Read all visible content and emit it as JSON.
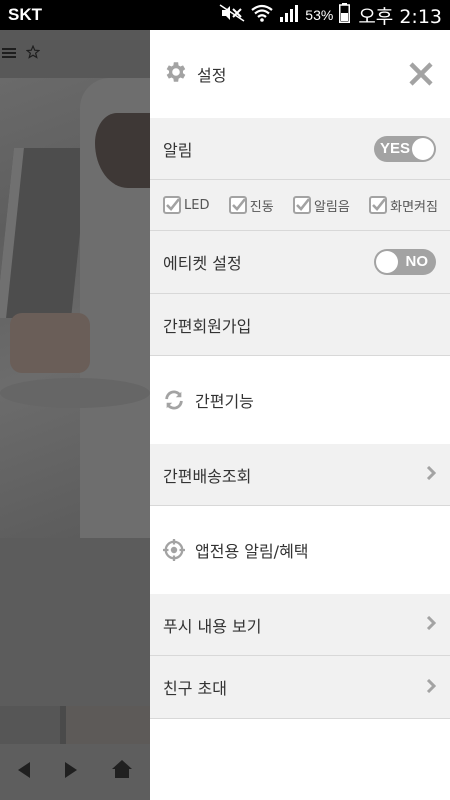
{
  "status_bar": {
    "carrier": "SKT",
    "battery_percent": "53%",
    "time": "오후 2:13",
    "icons": [
      "mute-icon",
      "wifi-icon",
      "signal-icon",
      "battery-icon"
    ]
  },
  "background_app": {
    "toolbar_icons": [
      "menu-icon",
      "star-icon"
    ],
    "nav_icons": [
      "back-arrow-icon",
      "forward-arrow-icon",
      "home-icon"
    ]
  },
  "drawer": {
    "header": {
      "icon": "gear-icon",
      "title": "설정",
      "close_icon": "close-icon"
    },
    "notification": {
      "label": "알림",
      "toggle": "YES",
      "toggle_state": "on"
    },
    "checkboxes": [
      {
        "label": "LED",
        "checked": true
      },
      {
        "label": "진동",
        "checked": true
      },
      {
        "label": "알림음",
        "checked": true
      },
      {
        "label": "화면켜짐",
        "checked": true
      }
    ],
    "etiquette": {
      "label": "에티켓 설정",
      "toggle": "NO",
      "toggle_state": "off"
    },
    "signup": {
      "label": "간편회원가입"
    },
    "easy_feature": {
      "icon": "refresh-icon",
      "label": "간편기능"
    },
    "delivery": {
      "label": "간편배송조회",
      "arrow": "chevron-right-icon"
    },
    "app_benefit": {
      "icon": "target-icon",
      "label": "앱전용 알림/혜택"
    },
    "push_view": {
      "label": "푸시 내용 보기",
      "arrow": "chevron-right-icon"
    },
    "invite": {
      "label": "친구 초대",
      "arrow": "chevron-right-icon"
    }
  },
  "colors": {
    "drawer_bg": "#ffffff",
    "row_gray": "#f1f1f1",
    "icon_gray": "#a3a3a3",
    "overlay": "#5a5a5a"
  }
}
